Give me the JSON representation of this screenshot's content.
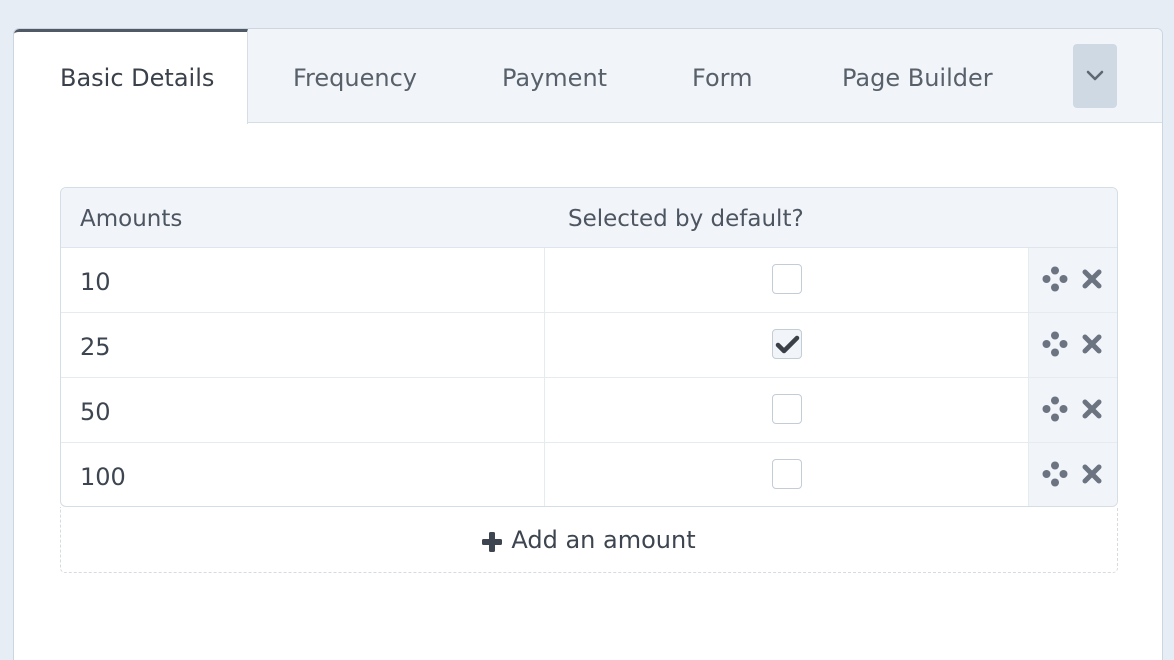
{
  "tabs": [
    {
      "label": "Basic Details",
      "active": true
    },
    {
      "label": "Frequency",
      "active": false
    },
    {
      "label": "Payment",
      "active": false
    },
    {
      "label": "Form",
      "active": false
    },
    {
      "label": "Page Builder",
      "active": false
    }
  ],
  "tab_overflow_icon": "chevron-down-icon",
  "table": {
    "headers": {
      "amounts": "Amounts",
      "selected": "Selected by default?"
    },
    "rows": [
      {
        "amount": "10",
        "selected": false
      },
      {
        "amount": "25",
        "selected": true
      },
      {
        "amount": "50",
        "selected": false
      },
      {
        "amount": "100",
        "selected": false
      }
    ],
    "row_icons": {
      "drag": "move-icon",
      "remove": "close-icon"
    }
  },
  "add_button": {
    "label": "Add an amount",
    "icon": "plus-icon"
  },
  "colors": {
    "background": "#e6edf5",
    "tab_bar": "#f1f5fa",
    "icon": "#6b7480",
    "text": "#3d4550"
  }
}
